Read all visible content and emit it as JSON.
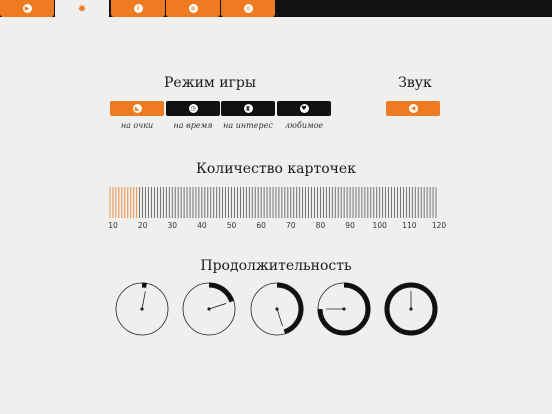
{
  "tabs": [
    {
      "name": "play",
      "icon": "play-icon",
      "glyph": "▶"
    },
    {
      "name": "settings",
      "icon": "gear-icon",
      "glyph": "✹",
      "active": true
    },
    {
      "name": "info",
      "icon": "info-icon",
      "glyph": "i"
    },
    {
      "name": "list",
      "icon": "list-icon",
      "glyph": "≡"
    },
    {
      "name": "share",
      "icon": "share-icon",
      "glyph": "◎"
    }
  ],
  "game_mode": {
    "title": "Режим игры",
    "options": [
      {
        "label": "на очки",
        "icon": "score-icon",
        "glyph": "◣",
        "selected": true
      },
      {
        "label": "на время",
        "icon": "clock-icon",
        "glyph": "◷",
        "selected": false
      },
      {
        "label": "на интерес",
        "icon": "hourglass-icon",
        "glyph": "⧗",
        "selected": false
      },
      {
        "label": "любимое",
        "icon": "heart-icon",
        "glyph": "♥",
        "selected": false
      }
    ]
  },
  "sound": {
    "title": "Звук",
    "icon": "speaker-icon",
    "glyph": "◀",
    "on": true
  },
  "cards": {
    "title": "Количество карточек",
    "ticks": [
      "10",
      "20",
      "30",
      "40",
      "50",
      "60",
      "70",
      "80",
      "90",
      "100",
      "110",
      "120"
    ],
    "min": 10,
    "max": 120,
    "selected": 20
  },
  "duration": {
    "title": "Продолжительность",
    "dials": [
      0.03,
      0.2,
      0.45,
      0.75,
      1.0
    ]
  },
  "colors": {
    "accent": "#ee7a22",
    "dark": "#111111",
    "background": "#efefed"
  }
}
